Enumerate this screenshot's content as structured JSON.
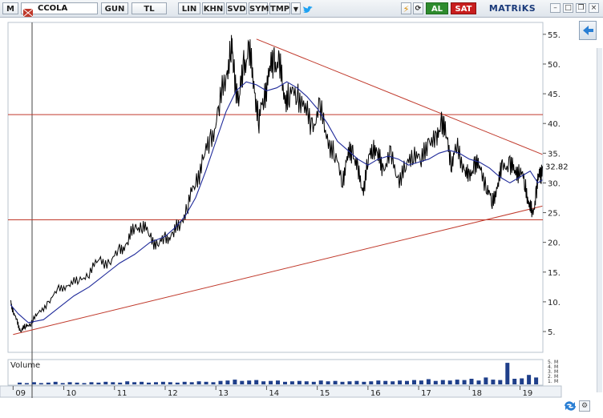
{
  "toolbar": {
    "menu_letter": "M",
    "symbol": "CCOLA",
    "period": "GUN",
    "currency": "TL",
    "scale": "LIN",
    "khn": "KHN",
    "svd": "SVD",
    "sym": "SYM",
    "tmp": "TMP",
    "buy": "AL",
    "sell": "SAT",
    "brand": "MATRiKS",
    "colors": {
      "buy": "#2e8b2e",
      "sell": "#c81e1e"
    }
  },
  "chart_data": {
    "type": "line",
    "price_y_ticks": [
      "55.",
      "50.",
      "45.",
      "40.",
      "35.",
      "30.",
      "25.",
      "20.",
      "15.",
      "10.",
      "5."
    ],
    "last_price_label": "32.82",
    "last_price": 32.82,
    "x_ticks": [
      "09",
      "10",
      "11",
      "12",
      "13",
      "14",
      "15",
      "16",
      "17",
      "18",
      "19"
    ],
    "ylim": [
      1.5,
      57
    ],
    "xlim": [
      2008.9,
      2019.45
    ],
    "volume_label": "Volume",
    "volume_ticks": [
      "5.",
      "M",
      "4.",
      "M",
      "3.",
      "M",
      "2.",
      "M",
      "1.",
      "M"
    ],
    "series": [
      {
        "color": "#000000",
        "x": [
          2008.95,
          2009.0,
          2009.08,
          2009.15,
          2009.25,
          2009.35,
          2009.5,
          2009.7,
          2009.9,
          2010.1,
          2010.3,
          2010.5,
          2010.7,
          2010.9,
          2011.1,
          2011.25,
          2011.4,
          2011.55,
          2011.7,
          2011.85,
          2012.0,
          2012.15,
          2012.3,
          2012.45,
          2012.6,
          2012.75,
          2012.9,
          2013.05,
          2013.2,
          2013.3,
          2013.35,
          2013.45,
          2013.55,
          2013.65,
          2013.75,
          2013.85,
          2013.95,
          2014.05,
          2014.15,
          2014.25,
          2014.35,
          2014.45,
          2014.6,
          2014.75,
          2014.9,
          2015.05,
          2015.2,
          2015.35,
          2015.5,
          2015.6,
          2015.7,
          2015.8,
          2015.9,
          2016.0,
          2016.1,
          2016.2,
          2016.3,
          2016.45,
          2016.6,
          2016.75,
          2016.9,
          2017.05,
          2017.2,
          2017.35,
          2017.45,
          2017.55,
          2017.65,
          2017.75,
          2017.9,
          2018.0,
          2018.1,
          2018.2,
          2018.35,
          2018.45,
          2018.55,
          2018.65,
          2018.8,
          2018.9,
          2019.0,
          2019.1,
          2019.18,
          2019.25,
          2019.32,
          2019.38,
          2019.44
        ],
        "values": [
          10.0,
          8.5,
          6.5,
          5.2,
          5.8,
          6.5,
          8.0,
          10.0,
          12.0,
          13.0,
          13.5,
          15.0,
          17.0,
          16.5,
          18.5,
          20.0,
          22.5,
          23.0,
          21.0,
          19.5,
          20.5,
          21.5,
          23.0,
          26.5,
          30.0,
          34.0,
          37.0,
          42.0,
          48.0,
          53.0,
          50.0,
          43.0,
          50.0,
          52.0,
          47.0,
          40.0,
          45.0,
          48.0,
          51.0,
          49.5,
          45.0,
          44.0,
          46.0,
          42.0,
          40.0,
          42.0,
          38.0,
          34.0,
          31.0,
          34.0,
          36.0,
          31.5,
          29.0,
          33.0,
          37.0,
          34.0,
          33.0,
          34.0,
          31.0,
          32.0,
          36.0,
          33.0,
          38.0,
          36.0,
          41.5,
          37.0,
          34.0,
          35.5,
          33.0,
          30.0,
          34.0,
          32.0,
          30.0,
          26.0,
          30.0,
          32.0,
          34.0,
          31.0,
          33.0,
          29.0,
          27.0,
          24.0,
          29.0,
          31.0,
          32.82
        ]
      },
      {
        "color": "#1f2a9a",
        "x": [
          2008.95,
          2009.1,
          2009.3,
          2009.6,
          2009.9,
          2010.2,
          2010.5,
          2010.8,
          2011.1,
          2011.4,
          2011.7,
          2012.0,
          2012.2,
          2012.4,
          2012.6,
          2012.8,
          2013.0,
          2013.2,
          2013.4,
          2013.6,
          2013.8,
          2014.0,
          2014.2,
          2014.4,
          2014.6,
          2014.8,
          2015.0,
          2015.2,
          2015.4,
          2015.6,
          2015.8,
          2016.0,
          2016.2,
          2016.4,
          2016.6,
          2016.8,
          2017.0,
          2017.2,
          2017.4,
          2017.6,
          2017.8,
          2018.0,
          2018.2,
          2018.4,
          2018.6,
          2018.8,
          2019.0,
          2019.2,
          2019.35,
          2019.44
        ],
        "values": [
          9.5,
          8.0,
          6.5,
          7.0,
          9.0,
          11.0,
          12.5,
          14.5,
          16.5,
          18.0,
          20.0,
          21.0,
          22.5,
          24.5,
          27.5,
          32.0,
          37.0,
          42.0,
          45.5,
          47.0,
          46.5,
          45.5,
          46.0,
          47.0,
          46.0,
          44.5,
          42.5,
          40.0,
          37.0,
          35.5,
          34.0,
          33.0,
          34.0,
          34.5,
          34.0,
          33.0,
          33.5,
          34.0,
          35.0,
          35.5,
          35.0,
          34.0,
          33.5,
          32.5,
          31.0,
          30.0,
          31.0,
          32.0,
          30.0,
          30.5
        ]
      }
    ],
    "volume": [
      0.4,
      0.3,
      0.5,
      0.3,
      0.4,
      0.6,
      0.3,
      0.5,
      0.4,
      0.3,
      0.5,
      0.4,
      0.6,
      0.5,
      0.4,
      0.7,
      0.5,
      0.6,
      0.4,
      0.5,
      0.6,
      0.5,
      0.4,
      0.6,
      0.5,
      0.7,
      0.6,
      0.5,
      0.8,
      0.9,
      1.1,
      0.8,
      0.9,
      1.0,
      0.7,
      0.8,
      0.9,
      0.6,
      0.7,
      0.8,
      0.7,
      0.6,
      0.9,
      0.7,
      0.8,
      0.6,
      0.7,
      0.8,
      0.6,
      0.7,
      0.9,
      0.8,
      0.7,
      0.9,
      0.8,
      1.0,
      0.9,
      1.2,
      0.8,
      1.0,
      0.9,
      1.1,
      1.0,
      1.3,
      0.9,
      1.6,
      1.1,
      1.0,
      5.0,
      1.3,
      1.4,
      2.2,
      1.6
    ]
  }
}
